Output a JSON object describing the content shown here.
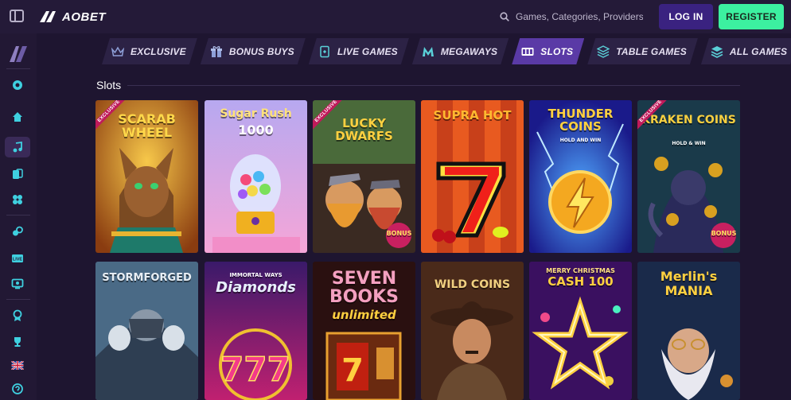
{
  "header": {
    "logo_text": "AOBET",
    "search_placeholder": "Games, Categories, Providers",
    "login_label": "LOG IN",
    "register_label": "REGISTER"
  },
  "colors": {
    "background": "#1e1530",
    "header": "#241a38",
    "tab": "#2c2245",
    "tab_active": "#5a3aa6",
    "login": "#3a2280",
    "register": "#3cf0a0",
    "accent_teal": "#3fd0e0"
  },
  "rail": {
    "icons": [
      "brand-icon",
      "sports-icon",
      "home-icon",
      "slots-icon",
      "cards-icon",
      "clover-icon",
      "chips-icon",
      "live-icon",
      "tv-icon",
      "badge-icon",
      "trophy-icon",
      "uk-flag-icon",
      "support-icon"
    ],
    "live_label": "LIVE"
  },
  "tabs": [
    {
      "label": "EXCLUSIVE",
      "icon": "crown-icon",
      "active": false
    },
    {
      "label": "BONUS BUYS",
      "icon": "gift-icon",
      "active": false
    },
    {
      "label": "LIVE GAMES",
      "icon": "live-card-icon",
      "active": false
    },
    {
      "label": "MEGAWAYS",
      "icon": "megaways-icon",
      "active": false
    },
    {
      "label": "SLOTS",
      "icon": "slots-reel-icon",
      "active": true
    },
    {
      "label": "TABLE GAMES",
      "icon": "stack-icon",
      "active": false
    },
    {
      "label": "ALL GAMES",
      "icon": "layers-icon",
      "active": false
    }
  ],
  "section": {
    "title": "Slots"
  },
  "games": [
    {
      "title": "SCARAB WHEEL",
      "badge": "EXCLUSIVE",
      "extra": ""
    },
    {
      "title": "Sugar Rush",
      "subtitle": "1000",
      "badge": "",
      "extra": ""
    },
    {
      "title": "LUCKY DWARFS",
      "badge": "EXCLUSIVE",
      "extra": "BONUS"
    },
    {
      "title": "SUPRA HOT",
      "badge": "",
      "extra": ""
    },
    {
      "title": "THUNDER COINS",
      "subtitle": "HOLD AND WIN",
      "badge": "",
      "extra": ""
    },
    {
      "title": "KRAKEN COINS",
      "subtitle": "HOLD & WIN",
      "badge": "EXCLUSIVE",
      "extra": "BONUS"
    },
    {
      "title": "STORMFORGED",
      "badge": "",
      "extra": ""
    },
    {
      "title": "Diamonds",
      "subtitle": "IMMORTAL WAYS",
      "badge": "",
      "extra": ""
    },
    {
      "title": "SEVEN BOOKS",
      "subtitle": "unlimited",
      "badge": "",
      "extra": ""
    },
    {
      "title": "WILD COINS",
      "badge": "",
      "extra": ""
    },
    {
      "title": "CASH 100",
      "subtitle": "MERRY CHRISTMAS",
      "badge": "",
      "extra": ""
    },
    {
      "title": "Merlin's MANIA",
      "badge": "",
      "extra": ""
    }
  ]
}
